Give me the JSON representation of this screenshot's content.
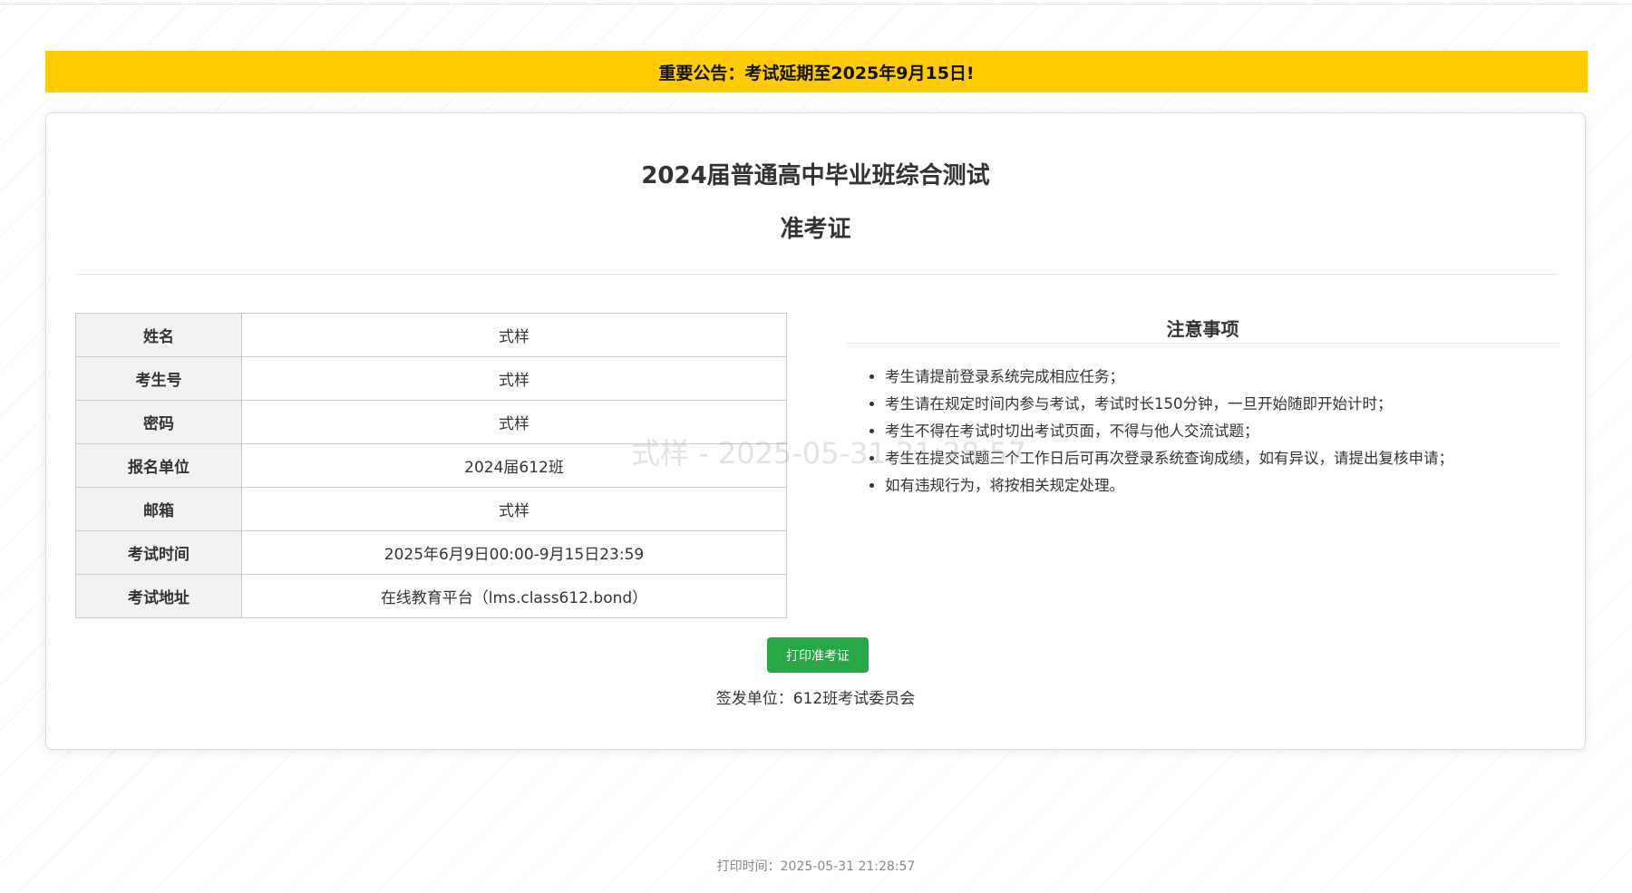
{
  "announcement": "重要公告：考试延期至2025年9月15日!",
  "exam_title": "2024届普通高中毕业班综合测试",
  "card_title": "准考证",
  "watermark": "式样 - 2025-05-31 21:28:57",
  "info_rows": [
    {
      "label": "姓名",
      "value": "式样"
    },
    {
      "label": "考生号",
      "value": "式样"
    },
    {
      "label": "密码",
      "value": "式样"
    },
    {
      "label": "报名单位",
      "value": "2024届612班"
    },
    {
      "label": "邮箱",
      "value": "式样"
    },
    {
      "label": "考试时间",
      "value": "2025年6月9日00:00-9月15日23:59"
    },
    {
      "label": "考试地址",
      "value": "在线教育平台（lms.class612.bond）"
    }
  ],
  "notice": {
    "title": "注意事项",
    "items": [
      "考生请提前登录系统完成相应任务；",
      "考生请在规定时间内参与考试，考试时长150分钟，一旦开始随即开始计时；",
      "考生不得在考试时切出考试页面，不得与他人交流试题；",
      "考生在提交试题三个工作日后可再次登录系统查询成绩，如有异议，请提出复核申请；",
      "如有违规行为，将按相关规定处理。"
    ]
  },
  "print_button_label": "打印准考证",
  "issuer": "签发单位：612班考试委员会",
  "print_time": "打印时间：2025-05-31 21:28:57",
  "colors": {
    "announcement_bg": "#ffcc00",
    "button_bg": "#28a745",
    "label_bg": "#f2f2f2"
  }
}
